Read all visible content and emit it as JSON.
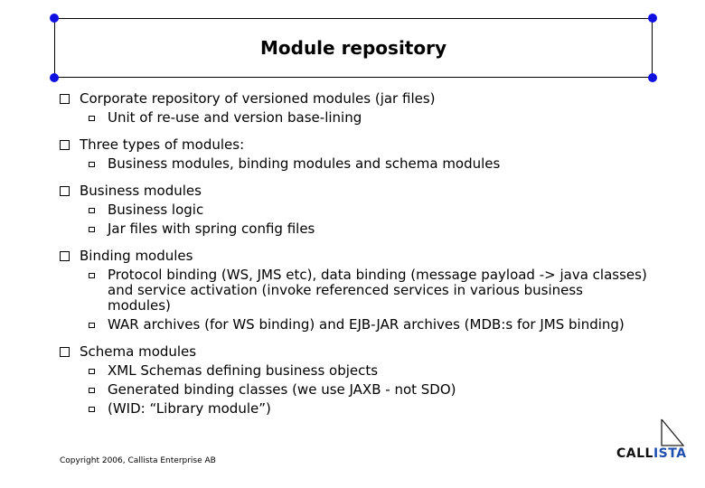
{
  "slide": {
    "title": "Module repository",
    "bullets": [
      {
        "text": "Corporate repository of versioned modules (jar files)",
        "sub": [
          "Unit of re-use and version base-lining"
        ]
      },
      {
        "text": "Three types of modules:",
        "sub": [
          "Business modules, binding modules and schema modules"
        ]
      },
      {
        "text": "Business modules",
        "sub": [
          "Business logic",
          "Jar files with spring config files"
        ]
      },
      {
        "text": "Binding modules",
        "sub": [
          "Protocol binding (WS, JMS etc), data binding (message payload -> java classes) and service activation (invoke referenced services in various business modules)",
          "WAR archives (for WS binding) and EJB-JAR archives (MDB:s for JMS binding)"
        ]
      },
      {
        "text": "Schema modules",
        "sub": [
          "XML Schemas defining business objects",
          "Generated binding classes (we use JAXB - not SDO)",
          "(WID: “Library module”)"
        ]
      }
    ],
    "footer": "Copyright 2006, Callista Enterprise AB",
    "logo": {
      "text_dark": "CALL",
      "text_blue": "ISTA",
      "icon": "triangle-icon"
    }
  },
  "colors": {
    "handle": "#1010e0",
    "logo_blue": "#1f4fb0"
  }
}
